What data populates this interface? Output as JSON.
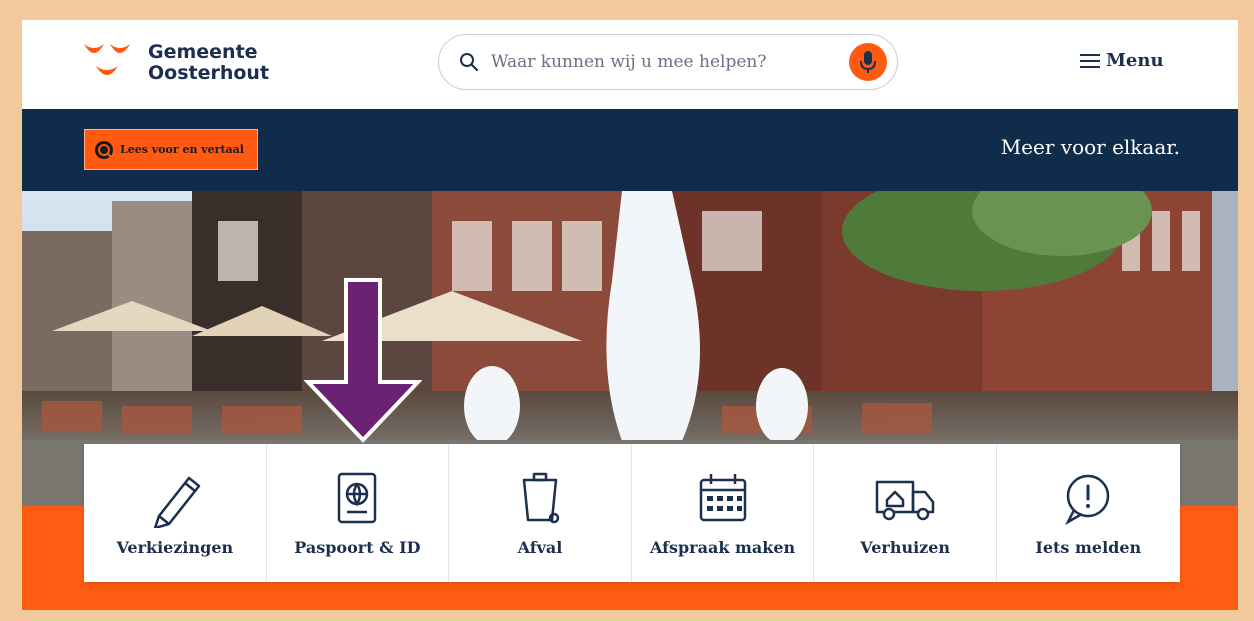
{
  "header": {
    "logo_line1": "Gemeente",
    "logo_line2": "Oosterhout",
    "search_placeholder": "Waar kunnen wij u mee helpen?",
    "menu_label": "Menu"
  },
  "bar": {
    "read_button_label": "Lees voor en vertaal",
    "slogan": "Meer voor elkaar."
  },
  "cards": [
    {
      "label": "Verkiezingen",
      "icon": "pencil-icon"
    },
    {
      "label": "Paspoort & ID",
      "icon": "passport-icon"
    },
    {
      "label": "Afval",
      "icon": "trash-bin-icon"
    },
    {
      "label": "Afspraak maken",
      "icon": "calendar-icon"
    },
    {
      "label": "Verhuizen",
      "icon": "moving-truck-icon"
    },
    {
      "label": "Iets melden",
      "icon": "alert-bubble-icon"
    }
  ],
  "colors": {
    "accent": "#ff5a12",
    "navy": "#0f2d4a",
    "text": "#1c2f4e",
    "arrow": "#6b2272",
    "frame": "#f2c99a"
  }
}
